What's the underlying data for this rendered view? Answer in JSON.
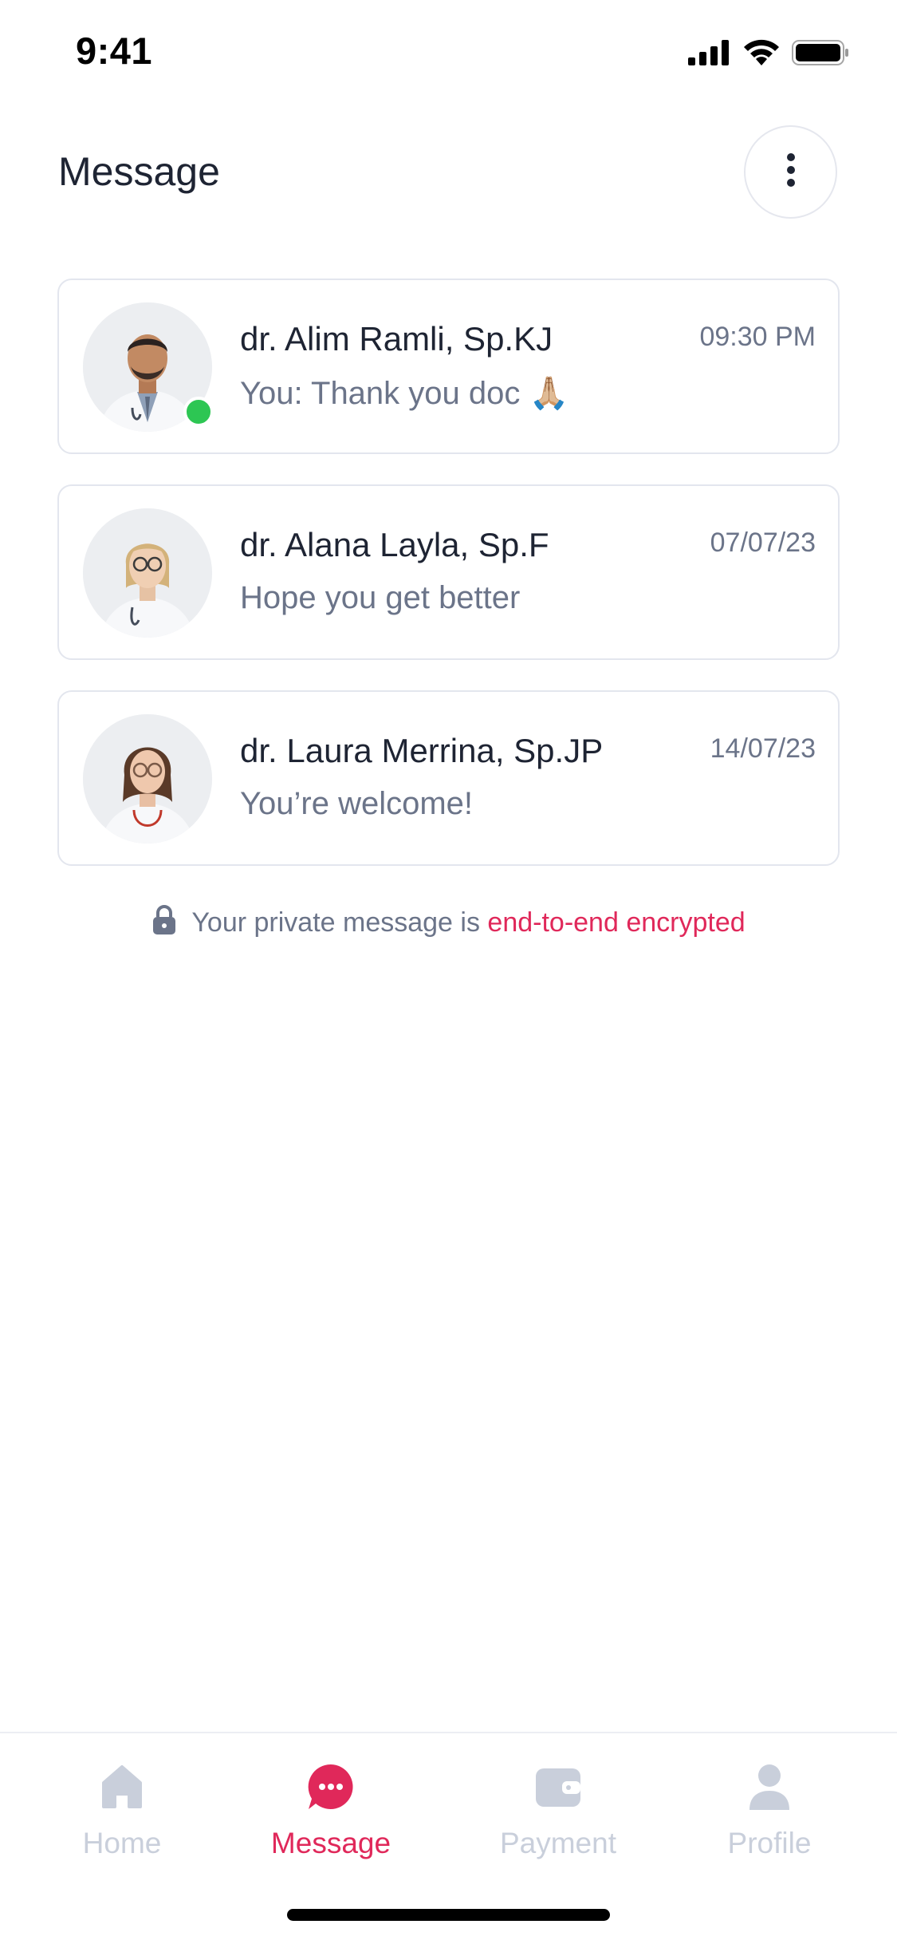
{
  "status_bar": {
    "time": "9:41",
    "icons": [
      "signal-icon",
      "wifi-icon",
      "battery-icon"
    ]
  },
  "header": {
    "title": "Message",
    "menu_icon": "more-vertical-icon"
  },
  "chats": [
    {
      "name": "dr. Alim Ramli, Sp.KJ",
      "preview": "You: Thank you doc 🙏🏼",
      "time": "09:30 PM",
      "online": true
    },
    {
      "name": "dr. Alana Layla, Sp.F",
      "preview": "Hope you get better",
      "time": "07/07/23",
      "online": false
    },
    {
      "name": "dr. Laura Merrina, Sp.JP",
      "preview": "You’re welcome!",
      "time": "14/07/23",
      "online": false
    }
  ],
  "encryption": {
    "icon": "lock-icon",
    "text": "Your private message is",
    "highlight": "end-to-end encrypted"
  },
  "nav": {
    "items": [
      {
        "label": "Home",
        "icon": "home-icon"
      },
      {
        "label": "Message",
        "icon": "chat-icon"
      },
      {
        "label": "Payment",
        "icon": "wallet-icon"
      },
      {
        "label": "Profile",
        "icon": "profile-icon"
      }
    ],
    "active": "Message"
  },
  "colors": {
    "accent": "#e0285a",
    "online": "#2dc653",
    "text_primary": "#1e2433",
    "text_secondary": "#6b7489",
    "nav_inactive": "#c9cfdb"
  }
}
